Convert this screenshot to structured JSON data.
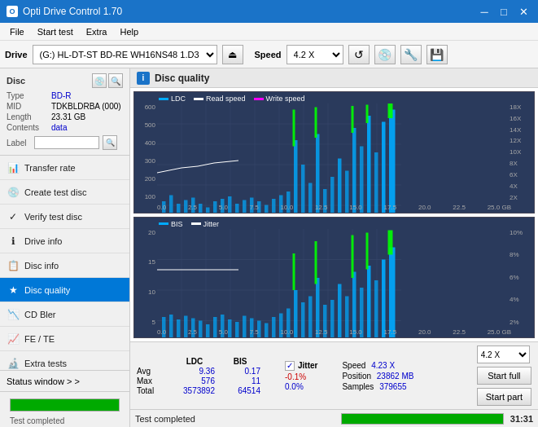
{
  "app": {
    "title": "Opti Drive Control 1.70",
    "icon": "O"
  },
  "title_controls": {
    "minimize": "─",
    "maximize": "□",
    "close": "✕"
  },
  "menu": {
    "items": [
      "File",
      "Start test",
      "Extra",
      "Help"
    ]
  },
  "drive_bar": {
    "label": "Drive",
    "drive_value": "(G:)  HL-DT-ST BD-RE  WH16NS48 1.D3",
    "eject_icon": "⏏",
    "speed_label": "Speed",
    "speed_value": "4.2 X",
    "icon1": "↺",
    "icon2": "💿",
    "icon3": "🔧",
    "icon4": "💾"
  },
  "disc_panel": {
    "title": "Disc",
    "type_label": "Type",
    "type_value": "BD-R",
    "mid_label": "MID",
    "mid_value": "TDKBLDRBA (000)",
    "length_label": "Length",
    "length_value": "23.31 GB",
    "contents_label": "Contents",
    "contents_value": "data",
    "label_label": "Label",
    "label_value": ""
  },
  "nav_items": [
    {
      "id": "transfer-rate",
      "label": "Transfer rate",
      "icon": "📊"
    },
    {
      "id": "create-test-disc",
      "label": "Create test disc",
      "icon": "💿"
    },
    {
      "id": "verify-test-disc",
      "label": "Verify test disc",
      "icon": "✓"
    },
    {
      "id": "drive-info",
      "label": "Drive info",
      "icon": "ℹ"
    },
    {
      "id": "disc-info",
      "label": "Disc info",
      "icon": "📋"
    },
    {
      "id": "disc-quality",
      "label": "Disc quality",
      "icon": "★",
      "active": true
    },
    {
      "id": "cd-bler",
      "label": "CD Bler",
      "icon": "📉"
    },
    {
      "id": "fe-te",
      "label": "FE / TE",
      "icon": "📈"
    },
    {
      "id": "extra-tests",
      "label": "Extra tests",
      "icon": "🔬"
    }
  ],
  "status_window": {
    "label": "Status window > >"
  },
  "progress": {
    "fill_percent": 100,
    "text": "Test completed"
  },
  "disc_quality": {
    "title": "Disc quality",
    "icon": "i",
    "legend": {
      "ldc_label": "LDC",
      "ldc_color": "#00aaff",
      "read_speed_label": "Read speed",
      "read_speed_color": "#ffffff",
      "write_speed_label": "Write speed",
      "write_speed_color": "#ff00ff"
    },
    "chart1": {
      "y_left_labels": [
        "600",
        "500",
        "400",
        "300",
        "200",
        "100"
      ],
      "y_right_labels": [
        "18X",
        "16X",
        "14X",
        "12X",
        "10X",
        "8X",
        "6X",
        "4X",
        "2X"
      ],
      "x_labels": [
        "0.0",
        "2.5",
        "5.0",
        "7.5",
        "10.0",
        "12.5",
        "15.0",
        "17.5",
        "20.0",
        "22.5",
        "25.0 GB"
      ]
    },
    "chart2": {
      "legend": {
        "bis_label": "BIS",
        "bis_color": "#00aaff",
        "jitter_label": "Jitter",
        "jitter_color": "#ffffff"
      },
      "y_left_labels": [
        "20",
        "15",
        "10",
        "5"
      ],
      "y_right_labels": [
        "10%",
        "8%",
        "6%",
        "4%",
        "2%"
      ],
      "x_labels": [
        "0.0",
        "2.5",
        "5.0",
        "7.5",
        "10.0",
        "12.5",
        "15.0",
        "17.5",
        "20.0",
        "22.5",
        "25.0 GB"
      ]
    }
  },
  "stats": {
    "col_ldc": "LDC",
    "col_bis": "BIS",
    "avg_label": "Avg",
    "avg_ldc": "9.36",
    "avg_bis": "0.17",
    "max_label": "Max",
    "max_ldc": "576",
    "max_bis": "11",
    "total_label": "Total",
    "total_ldc": "3573892",
    "total_bis": "64514",
    "jitter_label": "Jitter",
    "jitter_checked": "✓",
    "avg_jitter": "-0.1%",
    "max_jitter": "0.0%",
    "total_jitter": "",
    "speed_label": "Speed",
    "speed_value": "4.23 X",
    "position_label": "Position",
    "position_value": "23862 MB",
    "samples_label": "Samples",
    "samples_value": "379655",
    "speed_select": "4.2 X",
    "btn_start_full": "Start full",
    "btn_start_part": "Start part"
  },
  "bottom_bar": {
    "status_text": "Test completed",
    "progress_percent": 100,
    "time": "31:31"
  }
}
